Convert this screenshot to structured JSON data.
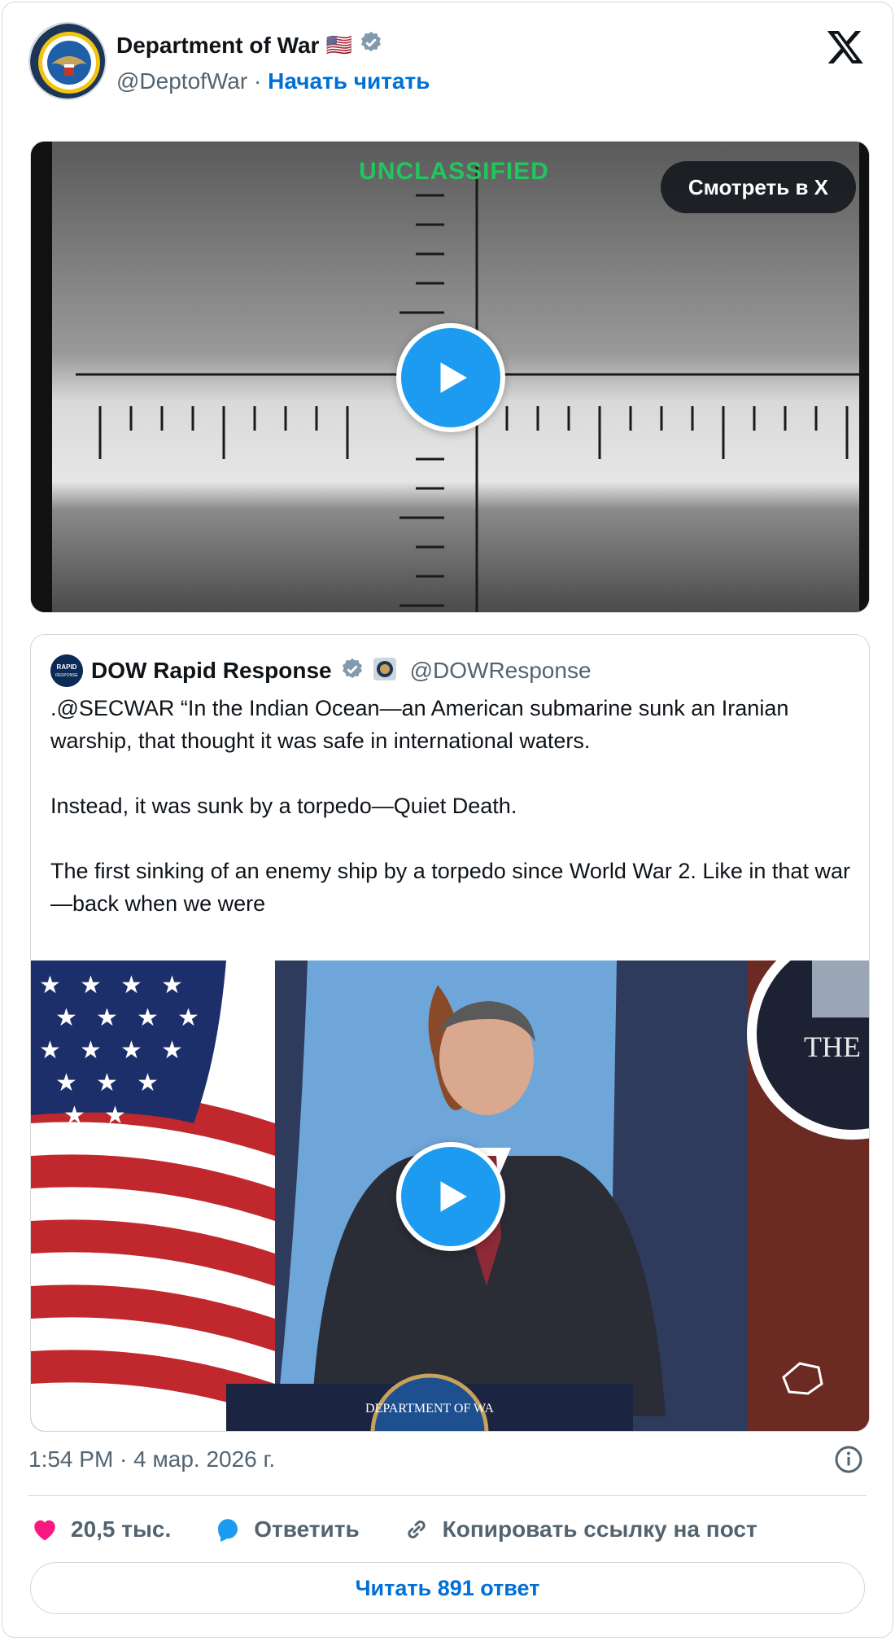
{
  "author": {
    "name": "Department of War",
    "flag": "🇺🇸",
    "handle": "@DeptofWar",
    "separator": "·",
    "follow_label": "Начать читать"
  },
  "media1": {
    "watermark": "UNCLASSIFIED",
    "watch_label": "Смотреть в X"
  },
  "quote": {
    "name": "DOW Rapid Response",
    "handle": "@DOWResponse",
    "avatar_text": "RAPID RESPONSE",
    "text": ".@SECWAR “In the Indian Ocean—an American submarine sunk an Iranian warship, that thought it was safe in international waters.\n\nInstead, it was sunk by a torpedo—Quiet Death.\n\nThe first sinking of an enemy ship by a torpedo since World War 2. Like in that war—back when we were",
    "podium_text": "DEPARTMENT OF WA",
    "seal_text": "THE"
  },
  "timestamp": "1:54 PM · 4 мар. 2026 г.",
  "actions": {
    "likes": "20,5 тыс.",
    "reply": "Ответить",
    "copy_link": "Копировать ссылку на пост"
  },
  "read_replies": "Читать 891 ответ",
  "colors": {
    "accent": "#1d9bf0",
    "link": "#006fd6",
    "like": "#f91880",
    "muted": "#536471",
    "watermark": "#22c55e"
  }
}
